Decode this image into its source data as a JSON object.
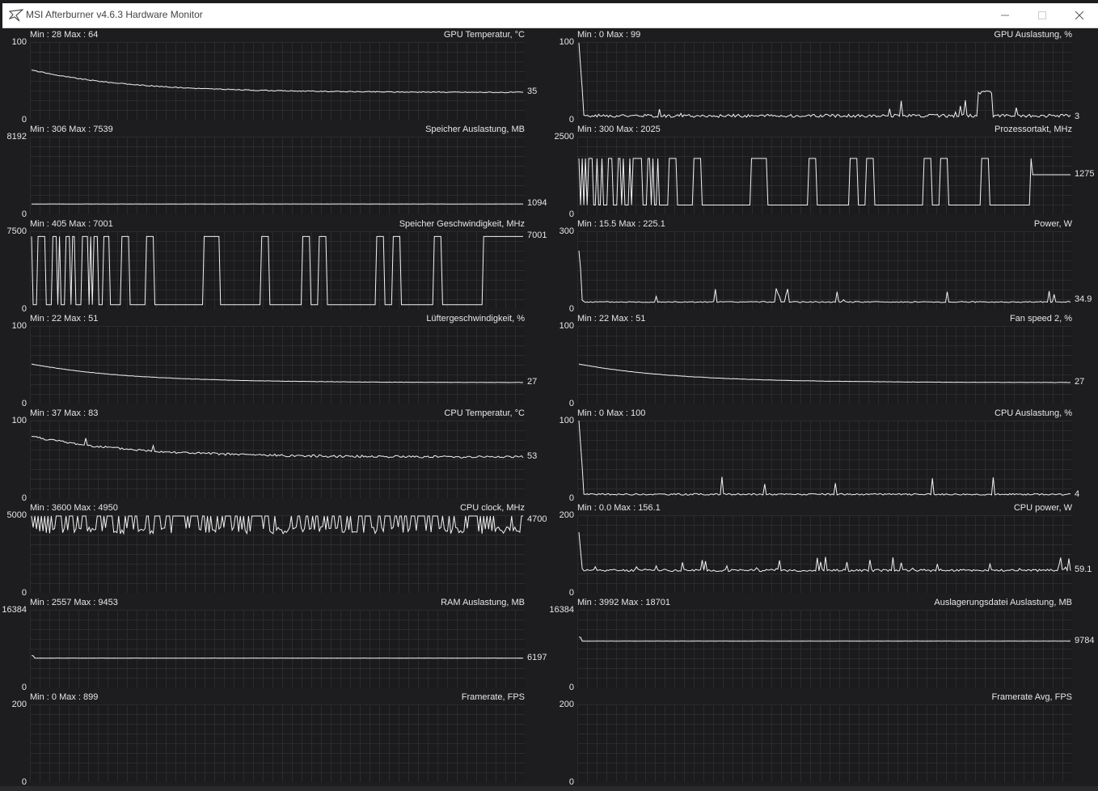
{
  "window": {
    "title": "MSI Afterburner v4.6.3 Hardware Monitor",
    "controls": [
      "minimize",
      "maximize",
      "close"
    ],
    "icon": "afterburner-plane-icon"
  },
  "panels": [
    {
      "id": "gpu-temp",
      "title": "GPU Temperatur, °C",
      "min_label": "Min : 28   Max : 64",
      "y_max": "100",
      "y_min": "0",
      "current": "35",
      "ymax_v": 100,
      "cur_v": 35,
      "shape": "decay",
      "peak": 64,
      "noise": 0.6,
      "spikes": 0
    },
    {
      "id": "gpu-load",
      "title": "GPU Auslastung, %",
      "min_label": "Min : 0   Max : 99",
      "y_max": "100",
      "y_min": "0",
      "current": "3",
      "ymax_v": 100,
      "cur_v": 3,
      "shape": "noise",
      "peak": 99,
      "base": 3,
      "noise": 4,
      "spikes": 22,
      "block": [
        0.81,
        0.84,
        33
      ]
    },
    {
      "id": "mem-usage",
      "title": "Speicher Auslastung, MB",
      "min_label": "Min : 306   Max : 7539",
      "y_max": "8192",
      "y_min": "0",
      "current": "1094",
      "ymax_v": 8192,
      "cur_v": 1094,
      "shape": "flat",
      "noise": 20,
      "spikes": 0
    },
    {
      "id": "core-clock",
      "title": "Prozessortakt, MHz",
      "min_label": "Min : 300   Max : 2025",
      "y_max": "2500",
      "y_min": "0",
      "current": "1275",
      "ymax_v": 2500,
      "cur_v": 1275,
      "shape": "square",
      "low": 300,
      "high": 1800,
      "mid": 1275
    },
    {
      "id": "mem-clock",
      "title": "Speicher Geschwindigkeit, MHz",
      "min_label": "Min : 405   Max : 7001",
      "y_max": "7500",
      "y_min": "0",
      "current": "7001",
      "ymax_v": 7500,
      "cur_v": 7001,
      "shape": "square",
      "low": 405,
      "high": 7001,
      "mid": 7001
    },
    {
      "id": "power",
      "title": "Power, W",
      "min_label": "Min : 15.5   Max : 225.1",
      "y_max": "300",
      "y_min": "0",
      "current": "34.9",
      "ymax_v": 300,
      "cur_v": 34.9,
      "shape": "noise",
      "peak": 225.1,
      "base": 25,
      "noise": 4,
      "spikes": 18
    },
    {
      "id": "fan-speed",
      "title": "Lüftergeschwindigkeit, %",
      "min_label": "Min : 22   Max : 51",
      "y_max": "100",
      "y_min": "0",
      "current": "27",
      "ymax_v": 100,
      "cur_v": 27,
      "shape": "decay",
      "peak": 51,
      "noise": 0.2,
      "spikes": 0
    },
    {
      "id": "fan-speed-2",
      "title": "Fan speed 2, %",
      "min_label": "Min : 22   Max : 51",
      "y_max": "100",
      "y_min": "0",
      "current": "27",
      "ymax_v": 100,
      "cur_v": 27,
      "shape": "decay",
      "peak": 51,
      "noise": 0.2,
      "spikes": 0
    },
    {
      "id": "cpu-temp",
      "title": "CPU Temperatur, °C",
      "min_label": "Min : 37   Max : 83",
      "y_max": "100",
      "y_min": "0",
      "current": "53",
      "ymax_v": 100,
      "cur_v": 53,
      "shape": "decay",
      "peak": 80,
      "noise": 1.5,
      "spikes": 8
    },
    {
      "id": "cpu-load",
      "title": "CPU Auslastung, %",
      "min_label": "Min : 0   Max : 100",
      "y_max": "100",
      "y_min": "0",
      "current": "4",
      "ymax_v": 100,
      "cur_v": 4,
      "shape": "noise",
      "peak": 100,
      "base": 4,
      "noise": 2,
      "spikes": 10
    },
    {
      "id": "cpu-clock",
      "title": "CPU clock, MHz",
      "min_label": "Min : 3600   Max : 4950",
      "y_max": "5000",
      "y_min": "0",
      "current": "4700",
      "ymax_v": 5000,
      "cur_v": 4700,
      "shape": "dense",
      "low": 3800,
      "high": 4950
    },
    {
      "id": "cpu-power",
      "title": "CPU power, W",
      "min_label": "Min : 0.0   Max : 156.1",
      "y_max": "200",
      "y_min": "0",
      "current": "59.1",
      "ymax_v": 200,
      "cur_v": 59.1,
      "shape": "noise",
      "peak": 156.1,
      "base": 55,
      "noise": 6,
      "spikes": 25
    },
    {
      "id": "ram-usage",
      "title": "RAM Auslastung, MB",
      "min_label": "Min : 2557   Max : 9453",
      "y_max": "16384",
      "y_min": "0",
      "current": "6197",
      "ymax_v": 16384,
      "cur_v": 6197,
      "shape": "flat",
      "noise": 30,
      "spikes": 0,
      "start": 6700
    },
    {
      "id": "pagefile-usage",
      "title": "Auslagerungsdatei Auslastung, MB",
      "min_label": "Min : 3992   Max : 18701",
      "y_max": "16384",
      "y_min": "0",
      "current": "9784",
      "ymax_v": 16384,
      "cur_v": 9784,
      "shape": "flat",
      "noise": 40,
      "spikes": 0,
      "start": 10600
    },
    {
      "id": "framerate",
      "title": "Framerate, FPS",
      "min_label": "Min : 0   Max : 899",
      "y_max": "200",
      "y_min": "0",
      "current": "",
      "ymax_v": 200,
      "cur_v": null,
      "shape": "empty"
    },
    {
      "id": "framerate-avg",
      "title": "Framerate Avg, FPS",
      "min_label": "",
      "y_max": "200",
      "y_min": "0",
      "current": "",
      "ymax_v": 200,
      "cur_v": null,
      "shape": "empty"
    }
  ],
  "colors": {
    "background": "#1d1d1f",
    "grid": "#2b2b2e",
    "graph_line": "#f2f2f2",
    "text": "#e6e6e6",
    "titlebar": "#ffffff"
  }
}
